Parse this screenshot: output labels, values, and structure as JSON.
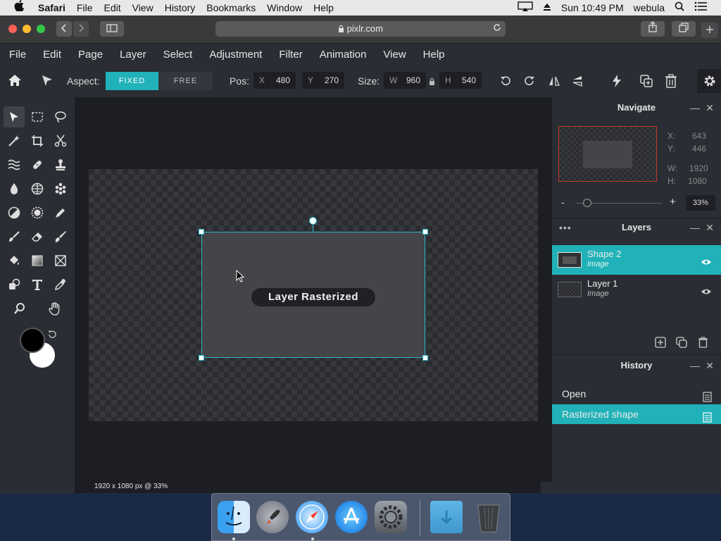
{
  "menubar": {
    "app": "Safari",
    "items": [
      "File",
      "Edit",
      "View",
      "History",
      "Bookmarks",
      "Window",
      "Help"
    ],
    "clock": "Sun 10:49 PM",
    "user": "webula"
  },
  "browser": {
    "url": "pixlr.com"
  },
  "pixlr_menu": [
    "File",
    "Edit",
    "Page",
    "Layer",
    "Select",
    "Adjustment",
    "Filter",
    "Animation",
    "View",
    "Help"
  ],
  "options": {
    "aspect_label": "Aspect:",
    "fixed_label": "FIXED",
    "free_label": "FREE",
    "pos_label": "Pos:",
    "pos_x_label": "X",
    "pos_x": "480",
    "pos_y_label": "Y",
    "pos_y": "270",
    "size_label": "Size:",
    "size_w_label": "W",
    "size_w": "960",
    "size_h_label": "H",
    "size_h": "540"
  },
  "canvas": {
    "toast": "Layer Rasterized",
    "status": "1920 x 1080 px @ 33%"
  },
  "navigate": {
    "title": "Navigate",
    "x_label": "X:",
    "x": "643",
    "y_label": "Y:",
    "y": "446",
    "w_label": "W:",
    "w": "1920",
    "h_label": "H:",
    "h": "1080",
    "zoom_minus": "-",
    "zoom_plus": "+",
    "zoom": "33%"
  },
  "layers": {
    "title": "Layers",
    "items": [
      {
        "name": "Shape 2",
        "type": "Image",
        "selected": true
      },
      {
        "name": "Layer 1",
        "type": "Image",
        "selected": false
      }
    ]
  },
  "history": {
    "title": "History",
    "items": [
      {
        "label": "Open",
        "selected": false
      },
      {
        "label": "Rasterized shape",
        "selected": true
      }
    ]
  },
  "colors": {
    "accent": "#20b2b8",
    "panel": "#2a2d33",
    "workspace": "#1c1e23",
    "foreground_color": "#000000",
    "background_color": "#ffffff"
  }
}
